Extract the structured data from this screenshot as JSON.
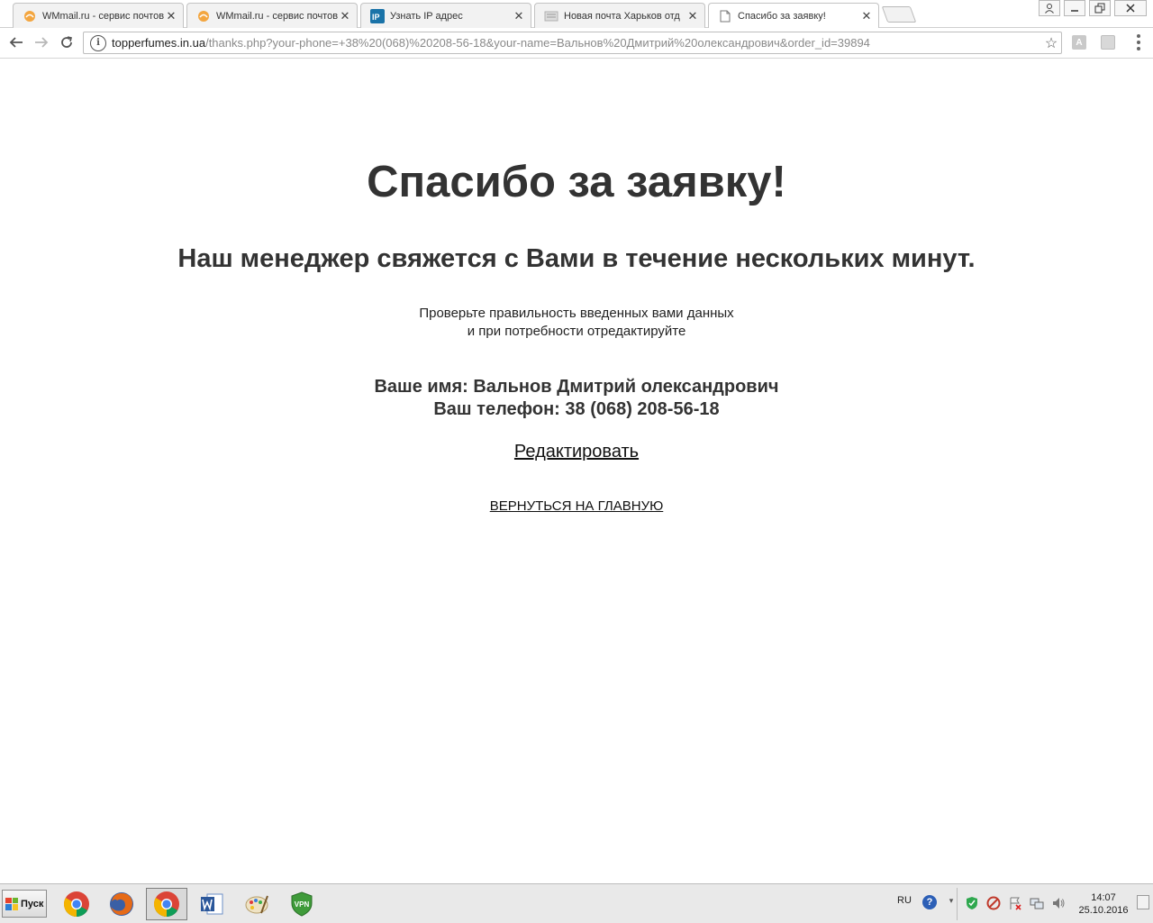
{
  "browser": {
    "tabs": [
      {
        "title": "WMmail.ru - сервис почтов",
        "icon": "wmmail-favicon-icon"
      },
      {
        "title": "WMmail.ru - сервис почтов",
        "icon": "wmmail-favicon-icon"
      },
      {
        "title": "Узнать IP адрес",
        "icon": "ip-favicon-icon",
        "badge": "IP"
      },
      {
        "title": "Новая почта Харьков отд",
        "icon": "nova-poshta-favicon-icon"
      },
      {
        "title": "Спасибо за заявку!",
        "icon": "page-favicon-icon"
      }
    ],
    "address": {
      "host": "topperfumes.in.ua",
      "path": "/thanks.php?your-phone=+38%20(068)%20208-56-18&your-name=Вальнов%20Дмитрий%20олександрович&order_id=39894"
    },
    "extensions": [
      {
        "icon": "extension-a-icon",
        "letter": "A"
      },
      {
        "icon": "extension-gray-icon"
      }
    ]
  },
  "page": {
    "heading": "Спасибо за заявку!",
    "subheading": "Наш менеджер свяжется с Вами в течение нескольких минут.",
    "note_line1": "Проверьте правильность введенных вами данных",
    "note_line2": "и при потребности отредактируйте",
    "name_line": "Ваше имя: Вальнов Дмитрий олександрович",
    "phone_line": "Ваш телефон: 38 (068) 208-56-18",
    "edit_link": "Редактировать",
    "home_link": "ВЕРНУТЬСЯ НА ГЛАВНУЮ"
  },
  "taskbar": {
    "start_label": "Пуск",
    "apps": [
      {
        "name": "chrome-icon"
      },
      {
        "name": "firefox-icon"
      },
      {
        "name": "chrome-icon",
        "active": true
      },
      {
        "name": "word-icon"
      },
      {
        "name": "paint-icon"
      },
      {
        "name": "vpn-icon",
        "label": "VPN"
      }
    ],
    "language": "RU",
    "clock_time": "14:07",
    "clock_date": "25.10.2016"
  },
  "colors": {
    "text": "#333333",
    "link": "#111111",
    "chrome_blue": "#4285f4",
    "taskbar_bg": "#e9e9e9"
  }
}
